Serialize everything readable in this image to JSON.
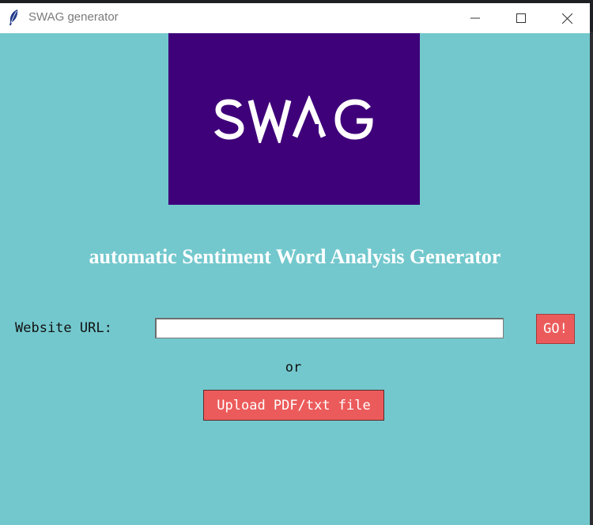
{
  "window": {
    "title": "SWAG generator",
    "minimize_icon": "minimize-icon",
    "maximize_icon": "maximize-icon",
    "close_icon": "close-icon",
    "app_icon": "feather-icon"
  },
  "logo": {
    "text": "SWAG",
    "background": "#3f017a"
  },
  "heading": "automatic Sentiment Word Analysis Generator",
  "form": {
    "url_label": "Website URL:",
    "url_value": "",
    "go_label": "GO!",
    "or_text": "or",
    "upload_label": "Upload PDF/txt file"
  },
  "colors": {
    "window_bg": "#73c8cd",
    "button_bg": "#ec5b5b",
    "heading_text": "#ffffff"
  }
}
